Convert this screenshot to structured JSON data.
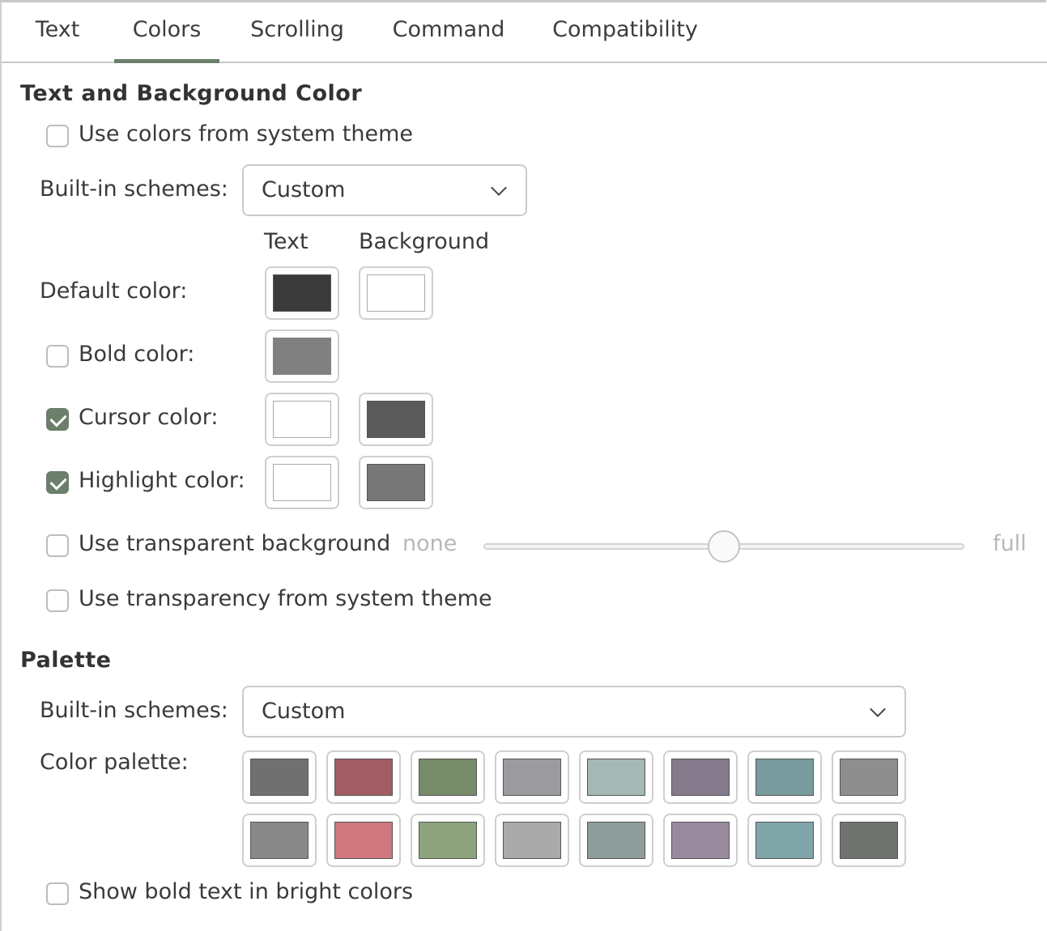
{
  "tabs": [
    {
      "label": "Text"
    },
    {
      "label": "Colors",
      "active": true
    },
    {
      "label": "Scrolling"
    },
    {
      "label": "Command"
    },
    {
      "label": "Compatibility"
    }
  ],
  "text_bg": {
    "title": "Text and Background Color",
    "use_system_theme": {
      "label": "Use colors from system theme",
      "checked": false
    },
    "builtin_label": "Built-in schemes:",
    "builtin_value": "Custom",
    "col_text": "Text",
    "col_background": "Background",
    "default_color": {
      "label": "Default color:",
      "text": "#3a3a3a",
      "background": "#ffffff"
    },
    "bold_color": {
      "label": "Bold color:",
      "checked": false,
      "text": "#808080"
    },
    "cursor_color": {
      "label": "Cursor color:",
      "checked": true,
      "text": "#ffffff",
      "background": "#5a5a5a"
    },
    "highlight_color": {
      "label": "Highlight color:",
      "checked": true,
      "text": "#ffffff",
      "background": "#777777"
    },
    "transparent_bg": {
      "label": "Use transparent background",
      "checked": false,
      "min_label": "none",
      "max_label": "full",
      "value": 0.5
    },
    "transparency_system": {
      "label": "Use transparency from system theme",
      "checked": false
    }
  },
  "palette": {
    "title": "Palette",
    "builtin_label": "Built-in schemes:",
    "builtin_value": "Custom",
    "color_palette_label": "Color palette:",
    "row1": [
      "#707070",
      "#a25c63",
      "#768b6a",
      "#9c9ca0",
      "#a6b8b5",
      "#847b8c",
      "#789c9e",
      "#8e8e8e"
    ],
    "row2": [
      "#888888",
      "#d07780",
      "#8ca37b",
      "#aaaaaa",
      "#8f9e9b",
      "#9a8a9e",
      "#80a6aa",
      "#707270"
    ],
    "bold_bright": {
      "label": "Show bold text in bright colors",
      "checked": false
    }
  },
  "accent": "#6b7f6b"
}
